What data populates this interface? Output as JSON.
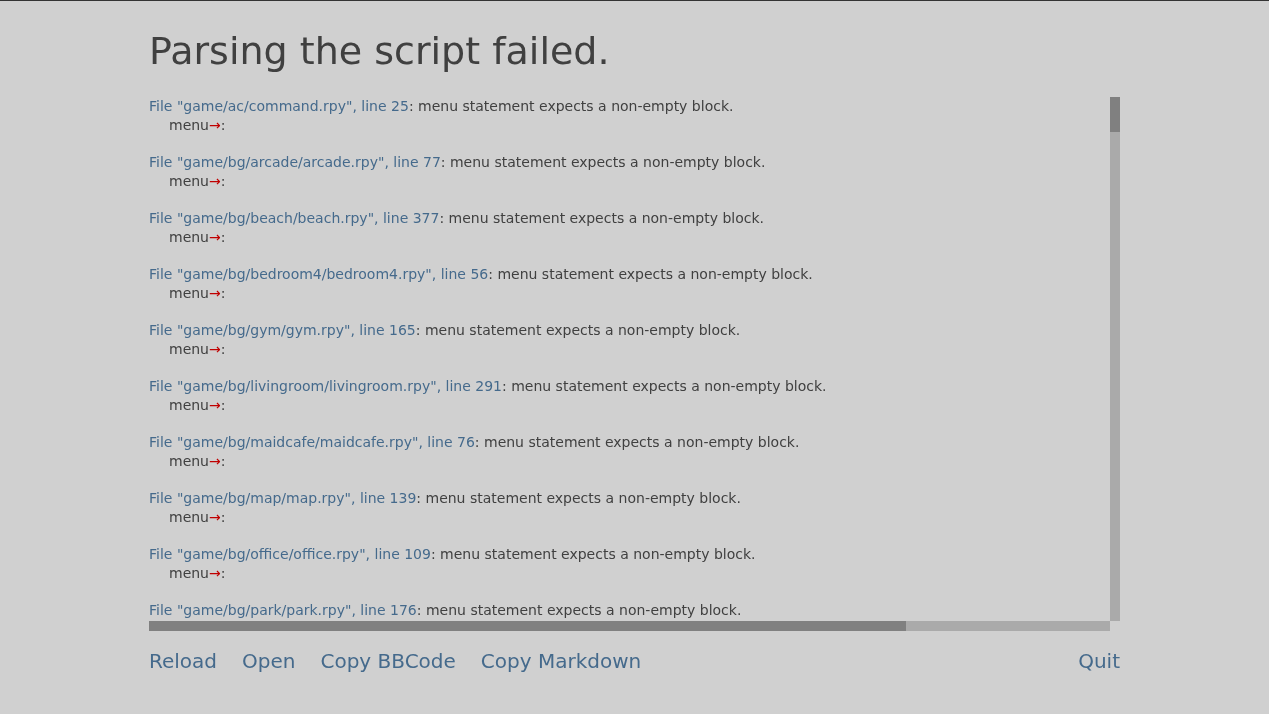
{
  "title": "Parsing the script failed.",
  "errors": [
    {
      "file": "File \"game/ac/command.rpy\", line 25",
      "message": ": menu statement expects a non-empty block.",
      "code": {
        "before": "menu",
        "arrow": "→",
        "after": ":"
      }
    },
    {
      "file": "File \"game/bg/arcade/arcade.rpy\", line 77",
      "message": ": menu statement expects a non-empty block.",
      "code": {
        "before": "menu",
        "arrow": "→",
        "after": ":"
      }
    },
    {
      "file": "File \"game/bg/beach/beach.rpy\", line 377",
      "message": ": menu statement expects a non-empty block.",
      "code": {
        "before": "menu",
        "arrow": "→",
        "after": ":"
      }
    },
    {
      "file": "File \"game/bg/bedroom4/bedroom4.rpy\", line 56",
      "message": ": menu statement expects a non-empty block.",
      "code": {
        "before": "menu",
        "arrow": "→",
        "after": ":"
      }
    },
    {
      "file": "File \"game/bg/gym/gym.rpy\", line 165",
      "message": ": menu statement expects a non-empty block.",
      "code": {
        "before": "menu",
        "arrow": "→",
        "after": ":"
      }
    },
    {
      "file": "File \"game/bg/livingroom/livingroom.rpy\", line 291",
      "message": ": menu statement expects a non-empty block.",
      "code": {
        "before": "menu",
        "arrow": "→",
        "after": ":"
      }
    },
    {
      "file": "File \"game/bg/maidcafe/maidcafe.rpy\", line 76",
      "message": ": menu statement expects a non-empty block.",
      "code": {
        "before": "menu",
        "arrow": "→",
        "after": ":"
      }
    },
    {
      "file": "File \"game/bg/map/map.rpy\", line 139",
      "message": ": menu statement expects a non-empty block.",
      "code": {
        "before": "menu",
        "arrow": "→",
        "after": ":"
      }
    },
    {
      "file": "File \"game/bg/office/office.rpy\", line 109",
      "message": ": menu statement expects a non-empty block.",
      "code": {
        "before": "menu",
        "arrow": "→",
        "after": ":"
      }
    },
    {
      "file": "File \"game/bg/park/park.rpy\", line 176",
      "message": ": menu statement expects a non-empty block."
    }
  ],
  "actions": [
    "Reload",
    "Open",
    "Copy BBCode",
    "Copy Markdown"
  ],
  "quit": "Quit"
}
